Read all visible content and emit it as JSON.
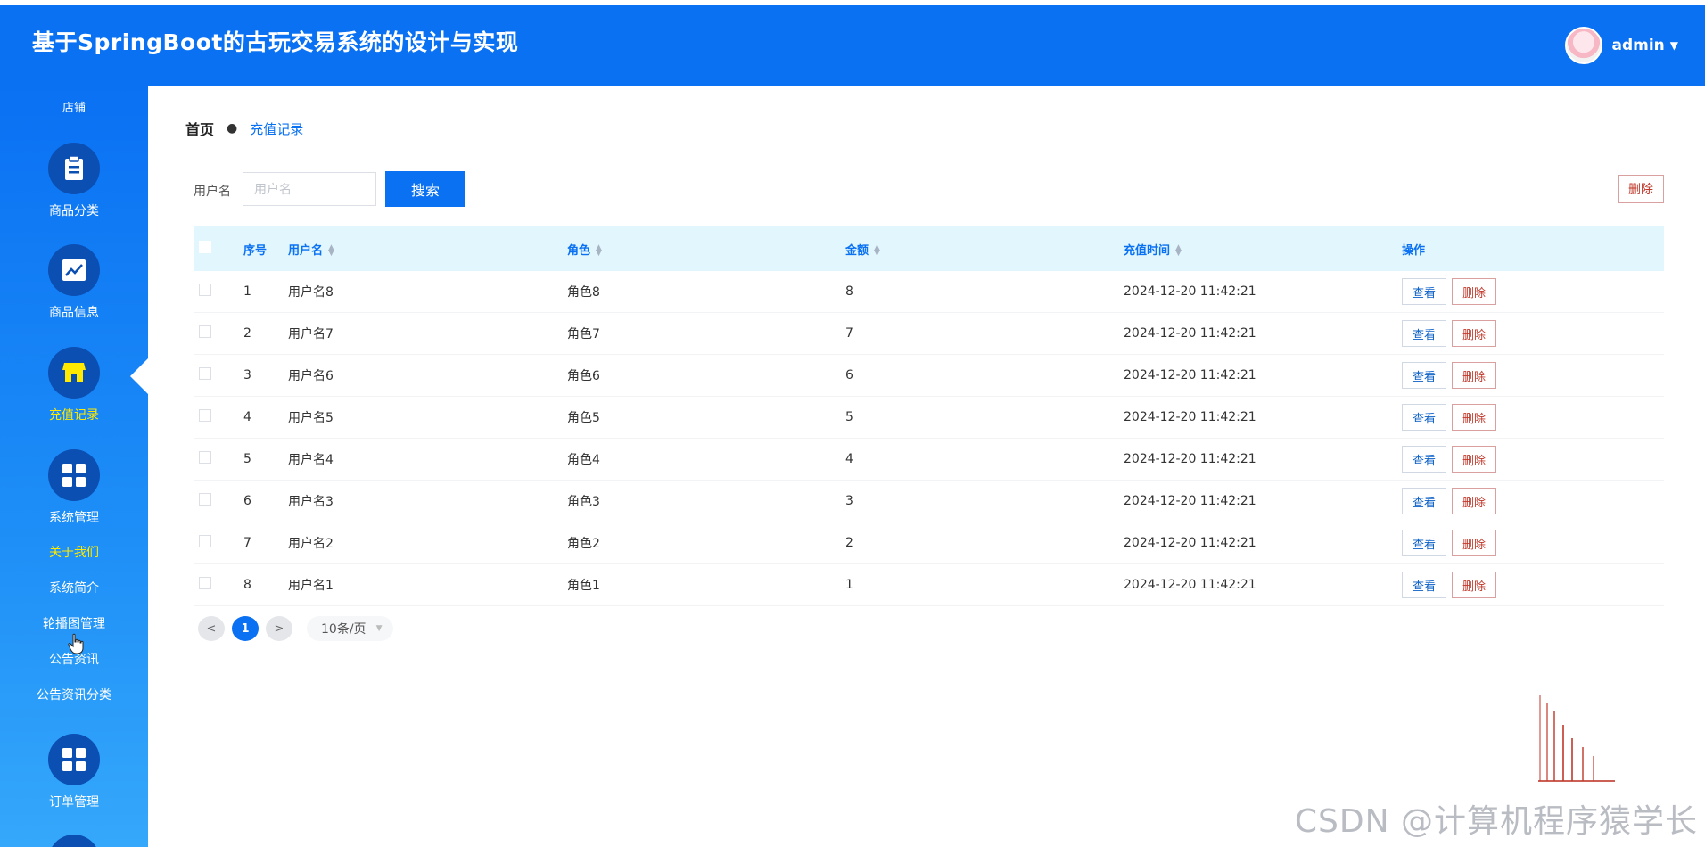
{
  "header": {
    "title": "基于SpringBoot的古玩交易系统的设计与实现",
    "user_name": "admin"
  },
  "sidebar": {
    "top_text": "店铺",
    "items": [
      {
        "label": "商品分类",
        "icon": "clipboard-icon"
      },
      {
        "label": "商品信息",
        "icon": "chart-icon"
      },
      {
        "label": "充值记录",
        "icon": "shop-icon"
      },
      {
        "label": "系统管理",
        "icon": "grid-icon"
      }
    ],
    "sub_items": [
      "关于我们",
      "系统简介",
      "轮播图管理",
      "公告资讯",
      "公告资讯分类"
    ],
    "bottom_item": {
      "label": "订单管理",
      "icon": "grid-icon"
    }
  },
  "breadcrumb": {
    "home": "首页",
    "current": "充值记录"
  },
  "search": {
    "label": "用户名",
    "placeholder": "用户名",
    "value": "",
    "button": "搜索"
  },
  "toolbar": {
    "delete": "删除"
  },
  "table": {
    "headers": [
      "序号",
      "用户名",
      "角色",
      "金额",
      "充值时间",
      "操作"
    ],
    "rows": [
      {
        "idx": "1",
        "user": "用户名8",
        "role": "角色8",
        "amount": "8",
        "time": "2024-12-20 11:42:21"
      },
      {
        "idx": "2",
        "user": "用户名7",
        "role": "角色7",
        "amount": "7",
        "time": "2024-12-20 11:42:21"
      },
      {
        "idx": "3",
        "user": "用户名6",
        "role": "角色6",
        "amount": "6",
        "time": "2024-12-20 11:42:21"
      },
      {
        "idx": "4",
        "user": "用户名5",
        "role": "角色5",
        "amount": "5",
        "time": "2024-12-20 11:42:21"
      },
      {
        "idx": "5",
        "user": "用户名4",
        "role": "角色4",
        "amount": "4",
        "time": "2024-12-20 11:42:21"
      },
      {
        "idx": "6",
        "user": "用户名3",
        "role": "角色3",
        "amount": "3",
        "time": "2024-12-20 11:42:21"
      },
      {
        "idx": "7",
        "user": "用户名2",
        "role": "角色2",
        "amount": "2",
        "time": "2024-12-20 11:42:21"
      },
      {
        "idx": "8",
        "user": "用户名1",
        "role": "角色1",
        "amount": "1",
        "time": "2024-12-20 11:42:21"
      }
    ],
    "view_label": "查看",
    "delete_label": "删除"
  },
  "pagination": {
    "prev": "<",
    "current": "1",
    "next": ">",
    "page_size": "10条/页"
  },
  "watermark": "CSDN @计算机程序猿学长",
  "colors": {
    "primary": "#0a71f3",
    "active_text": "#ffea00",
    "danger": "#c0392b",
    "table_header_bg": "#e2f6fd"
  }
}
